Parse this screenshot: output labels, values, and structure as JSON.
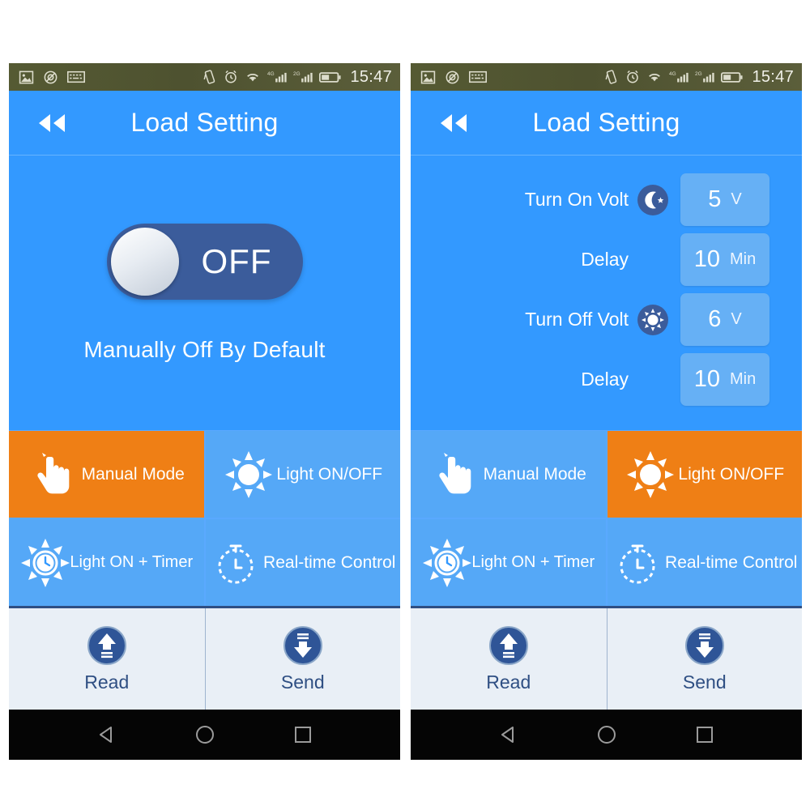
{
  "theme": {
    "blue": "#3399ff",
    "blue_light": "#55a8f7",
    "orange": "#ef7f15",
    "navy": "#3b5c9b",
    "footer_bg": "#e9eff6",
    "footer_text": "#2f4f83",
    "value_box": "#66b0f5",
    "statusbar": "#555a33"
  },
  "statusbar": {
    "left_icons": [
      "image-icon",
      "no-sim-icon",
      "keyboard-icon"
    ],
    "right_icons": [
      "vibrate-icon",
      "alarm-icon",
      "wifi-icon",
      "signal-4g-icon",
      "signal-2g-icon",
      "battery-icon"
    ],
    "signal_labels": [
      "4G",
      "2G"
    ],
    "time": "15:47"
  },
  "header": {
    "title": "Load Setting",
    "back_icon": "rewind-back-icon"
  },
  "left_panel": {
    "toggle": {
      "state_label": "OFF",
      "state_on": false,
      "caption": "Manually Off By Default"
    },
    "modes": [
      {
        "label": "Manual Mode",
        "icon": "hand-tap-icon",
        "active": true
      },
      {
        "label": "Light ON/OFF",
        "icon": "sun-icon",
        "active": false
      },
      {
        "label": "Light ON + Timer",
        "icon": "sun-clock-icon",
        "active": false
      },
      {
        "label": "Real-time Control",
        "icon": "stopwatch-icon",
        "active": false
      }
    ],
    "footer": [
      {
        "label": "Read",
        "icon": "upload-arrow-icon"
      },
      {
        "label": "Send",
        "icon": "download-arrow-icon"
      }
    ]
  },
  "right_panel": {
    "settings": [
      {
        "label": "Turn On Volt",
        "icon": "moon-star-icon",
        "value": "5",
        "unit": "V"
      },
      {
        "label": "Delay",
        "icon": "none",
        "value": "10",
        "unit": "Min"
      },
      {
        "label": "Turn Off Volt",
        "icon": "sun-circle-icon",
        "value": "6",
        "unit": "V"
      },
      {
        "label": "Delay",
        "icon": "none",
        "value": "10",
        "unit": "Min"
      }
    ],
    "modes": [
      {
        "label": "Manual Mode",
        "icon": "hand-tap-icon",
        "active": false
      },
      {
        "label": "Light ON/OFF",
        "icon": "sun-icon",
        "active": true
      },
      {
        "label": "Light ON + Timer",
        "icon": "sun-clock-icon",
        "active": false
      },
      {
        "label": "Real-time Control",
        "icon": "stopwatch-icon",
        "active": false
      }
    ],
    "footer": [
      {
        "label": "Read",
        "icon": "upload-arrow-icon"
      },
      {
        "label": "Send",
        "icon": "download-arrow-icon"
      }
    ]
  },
  "navbar": {
    "buttons": [
      "back-triangle-icon",
      "home-circle-icon",
      "recents-square-icon"
    ]
  }
}
